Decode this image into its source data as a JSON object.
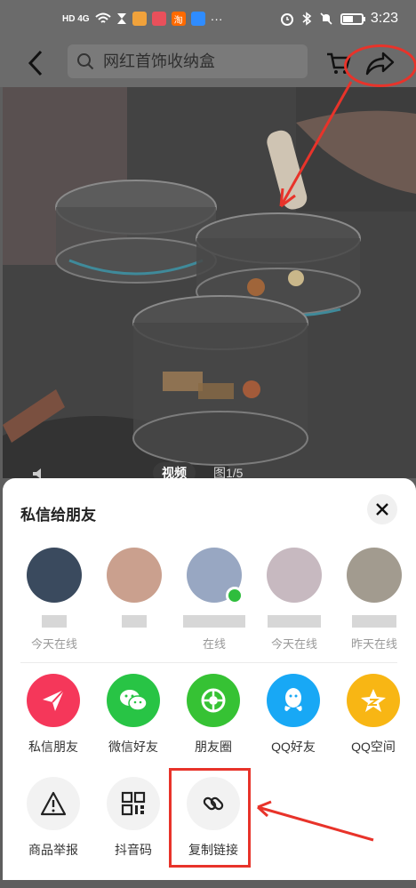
{
  "status_bar": {
    "network": "HD 4G",
    "time": "3:23",
    "battery_level": 0.55
  },
  "nav": {
    "search_placeholder": "网红首饰收纳盒"
  },
  "media": {
    "tab_video": "视频",
    "tab_image": "图1/5"
  },
  "sheet": {
    "title": "私信给朋友",
    "friends": [
      {
        "status": "今天在线",
        "color": "#3a4a5e"
      },
      {
        "status": "",
        "color": "#caa08e"
      },
      {
        "status": "在线",
        "color": "#98a7c2",
        "online": true
      },
      {
        "status": "今天在线",
        "color": "#c7b9c0"
      },
      {
        "status": "昨天在线",
        "color": "#a29b8f"
      }
    ],
    "share_targets": [
      {
        "label": "私信朋友",
        "color": "#f5375a",
        "icon": "paper-plane-icon"
      },
      {
        "label": "微信好友",
        "color": "#28c445",
        "icon": "wechat-icon"
      },
      {
        "label": "朋友圈",
        "color": "#36c234",
        "icon": "moments-icon"
      },
      {
        "label": "QQ好友",
        "color": "#18a8f5",
        "icon": "qq-icon"
      },
      {
        "label": "QQ空间",
        "color": "#f8b614",
        "icon": "qzone-icon"
      }
    ],
    "actions": [
      {
        "label": "商品举报",
        "icon": "warning-icon"
      },
      {
        "label": "抖音码",
        "icon": "qr-code-icon"
      },
      {
        "label": "复制链接",
        "icon": "link-icon"
      }
    ]
  },
  "colors": {
    "annotation": "#e8332a",
    "online": "#2fbd3d"
  }
}
